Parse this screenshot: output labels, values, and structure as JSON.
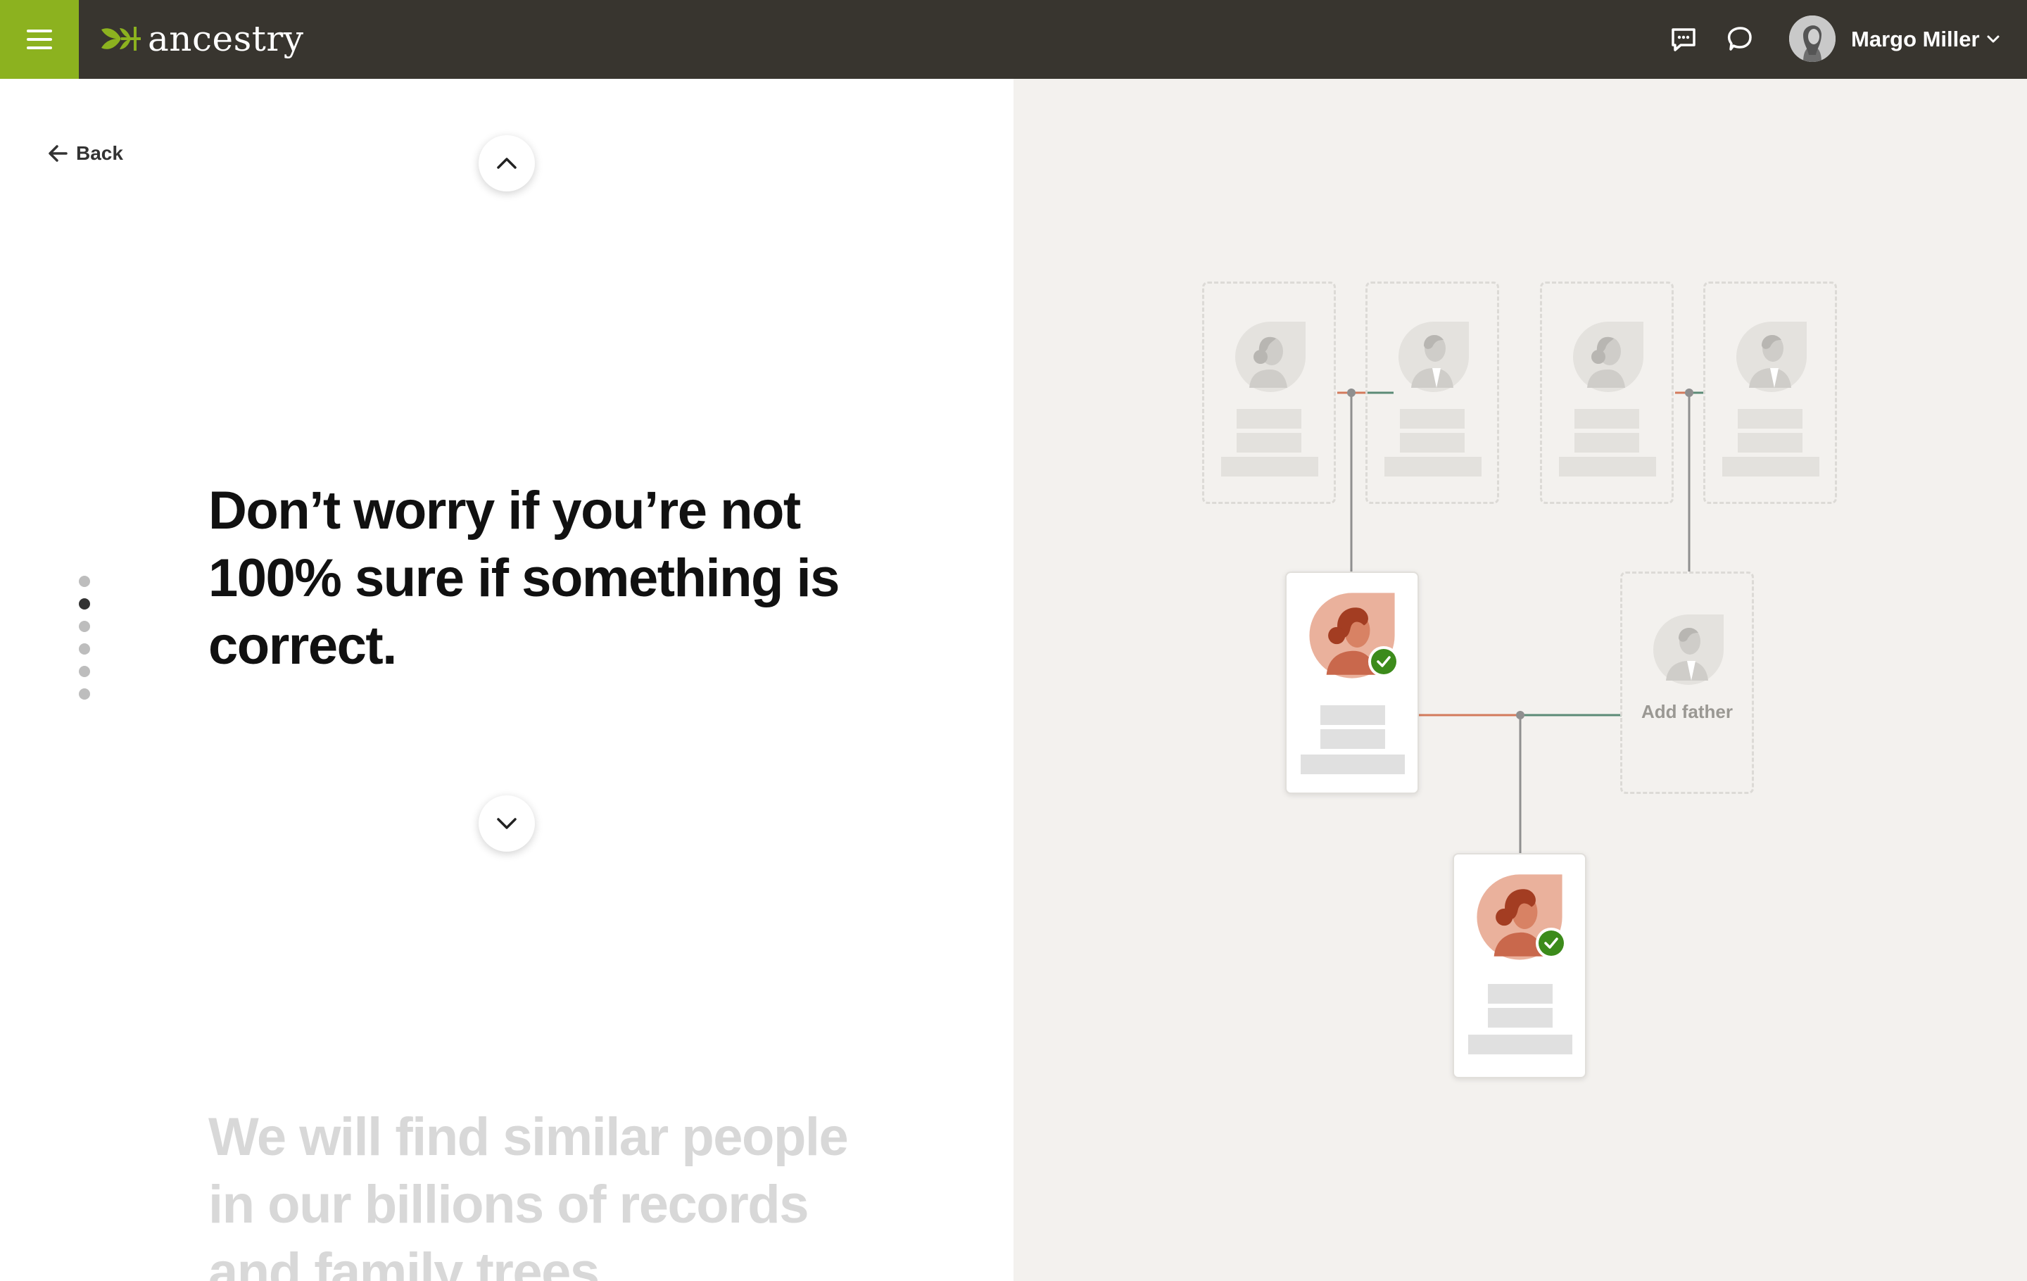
{
  "brand": {
    "name": "ancestry",
    "accent": "#8cb21f",
    "topbar_bg": "#38352f"
  },
  "user": {
    "name": "Margo Miller"
  },
  "nav": {
    "back_label": "Back"
  },
  "onboarding": {
    "steps_total": 6,
    "active_step": 2,
    "heading": "Don’t worry if you’re not 100% sure if something is correct.",
    "next_heading": "We will find similar people in our billions of records and family trees."
  },
  "tree": {
    "add_father_label": "Add father",
    "verified_color": "#3c8b1b"
  },
  "icons": {
    "menu": "hamburger-icon",
    "messages": "message-icon",
    "hints": "chat-bubble-icon",
    "back": "arrow-left-icon",
    "scroll_up": "chevron-up-icon",
    "scroll_down": "chevron-down-icon",
    "verified": "check-icon"
  }
}
